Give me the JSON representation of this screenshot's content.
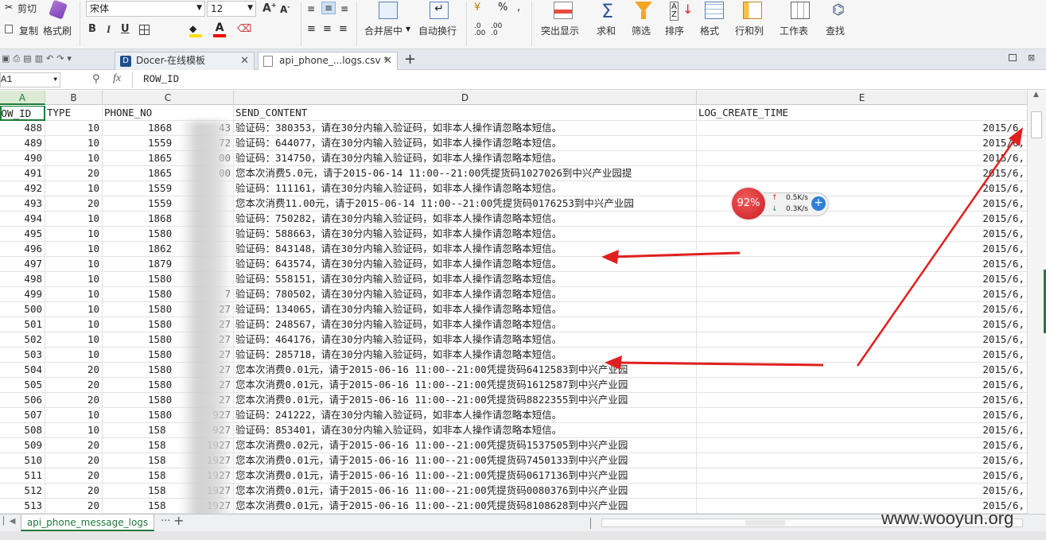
{
  "ribbon": {
    "cut": "剪切",
    "copy": "复制",
    "format_painter": "格式刷",
    "font_name": "宋体",
    "font_size": "12",
    "merge_center": "合并居中",
    "wrap_text": "自动换行",
    "percent": "%",
    "highlight": "突出显示",
    "sum": "求和",
    "filter": "筛选",
    "sort": "排序",
    "format": "格式",
    "row_col": "行和列",
    "worksheet": "工作表",
    "find": "查找",
    "bold": "B",
    "italic": "I",
    "underline": "U",
    "sigma": "Σ"
  },
  "tabs": [
    {
      "label": "Docer-在线模板"
    },
    {
      "label": "api_phone_...logs.csv *"
    }
  ],
  "formula_bar": {
    "name_box": "A1",
    "fx": "fx",
    "content": "ROW_ID"
  },
  "columns": [
    "A",
    "B",
    "C",
    "D",
    "E"
  ],
  "header_row": [
    "ROW_ID",
    "TYPE",
    "PHONE_NO",
    "SEND_CONTENT",
    "LOG_CREATE_TIME"
  ],
  "rows": [
    {
      "id": "488",
      "type": "10",
      "phone": "1868",
      "phone_tail": "43",
      "content": "验证码：380353，请在30分内输入验证码，如非本人操作请忽略本短信。",
      "time": "2015/6,"
    },
    {
      "id": "489",
      "type": "10",
      "phone": "1559",
      "phone_tail": "72",
      "content": "验证码：644077，请在30分内输入验证码，如非本人操作请忽略本短信。",
      "time": "2015/6,"
    },
    {
      "id": "490",
      "type": "10",
      "phone": "1865",
      "phone_tail": "00",
      "content": "验证码：314750，请在30分内输入验证码，如非本人操作请忽略本短信。",
      "time": "2015/6,"
    },
    {
      "id": "491",
      "type": "20",
      "phone": "1865",
      "phone_tail": "00",
      "content": "您本次消费5.0元，请于2015-06-14 11:00--21:00凭提货码1027026到中兴产业园提",
      "time": "2015/6,"
    },
    {
      "id": "492",
      "type": "10",
      "phone": "1559",
      "phone_tail": "",
      "content": "验证码：111161，请在30分内输入验证码，如非本人操作请忽略本短信。",
      "time": "2015/6,"
    },
    {
      "id": "493",
      "type": "20",
      "phone": "1559",
      "phone_tail": "",
      "content": "您本次消费11.00元，请于2015-06-14 11:00--21:00凭提货码0176253到中兴产业园",
      "time": "2015/6,"
    },
    {
      "id": "494",
      "type": "10",
      "phone": "1868",
      "phone_tail": "",
      "content": "验证码：750282，请在30分内输入验证码，如非本人操作请忽略本短信。",
      "time": "2015/6,"
    },
    {
      "id": "495",
      "type": "10",
      "phone": "1580",
      "phone_tail": "",
      "content": "验证码：588663，请在30分内输入验证码，如非本人操作请忽略本短信。",
      "time": "2015/6,"
    },
    {
      "id": "496",
      "type": "10",
      "phone": "1862",
      "phone_tail": "",
      "content": "验证码：843148，请在30分内输入验证码，如非本人操作请忽略本短信。",
      "time": "2015/6,"
    },
    {
      "id": "497",
      "type": "10",
      "phone": "1879",
      "phone_tail": "",
      "content": "验证码：643574，请在30分内输入验证码，如非本人操作请忽略本短信。",
      "time": "2015/6,"
    },
    {
      "id": "498",
      "type": "10",
      "phone": "1580",
      "phone_tail": "",
      "content": "验证码：558151，请在30分内输入验证码，如非本人操作请忽略本短信。",
      "time": "2015/6,"
    },
    {
      "id": "499",
      "type": "10",
      "phone": "1580",
      "phone_tail": "7",
      "content": "验证码：780502，请在30分内输入验证码，如非本人操作请忽略本短信。",
      "time": "2015/6,"
    },
    {
      "id": "500",
      "type": "10",
      "phone": "1580",
      "phone_tail": "27",
      "content": "验证码：134065，请在30分内输入验证码，如非本人操作请忽略本短信。",
      "time": "2015/6,"
    },
    {
      "id": "501",
      "type": "10",
      "phone": "1580",
      "phone_tail": "27",
      "content": "验证码：248567，请在30分内输入验证码，如非本人操作请忽略本短信。",
      "time": "2015/6,"
    },
    {
      "id": "502",
      "type": "10",
      "phone": "1580",
      "phone_tail": "27",
      "content": "验证码：464176，请在30分内输入验证码，如非本人操作请忽略本短信。",
      "time": "2015/6,"
    },
    {
      "id": "503",
      "type": "10",
      "phone": "1580",
      "phone_tail": "27",
      "content": "验证码：285718，请在30分内输入验证码，如非本人操作请忽略本短信。",
      "time": "2015/6,"
    },
    {
      "id": "504",
      "type": "20",
      "phone": "1580",
      "phone_tail": "27",
      "content": "您本次消费0.01元，请于2015-06-16 11:00--21:00凭提货码6412583到中兴产业园",
      "time": "2015/6,"
    },
    {
      "id": "505",
      "type": "20",
      "phone": "1580",
      "phone_tail": "27",
      "content": "您本次消费0.01元，请于2015-06-16 11:00--21:00凭提货码1612587到中兴产业园",
      "time": "2015/6,"
    },
    {
      "id": "506",
      "type": "20",
      "phone": "1580",
      "phone_tail": "27",
      "content": "您本次消费0.01元，请于2015-06-16 11:00--21:00凭提货码8822355到中兴产业园",
      "time": "2015/6,"
    },
    {
      "id": "507",
      "type": "10",
      "phone": "1580",
      "phone_tail": "927",
      "content": "验证码：241222，请在30分内输入验证码，如非本人操作请忽略本短信。",
      "time": "2015/6,"
    },
    {
      "id": "508",
      "type": "10",
      "phone": "158",
      "phone_tail": "927",
      "content": "验证码：853401，请在30分内输入验证码，如非本人操作请忽略本短信。",
      "time": "2015/6,"
    },
    {
      "id": "509",
      "type": "20",
      "phone": "158",
      "phone_tail": "1927",
      "content": "您本次消费0.02元，请于2015-06-16 11:00--21:00凭提货码1537505到中兴产业园",
      "time": "2015/6,"
    },
    {
      "id": "510",
      "type": "20",
      "phone": "158",
      "phone_tail": "1927",
      "content": "您本次消费0.01元，请于2015-06-16 11:00--21:00凭提货码7450133到中兴产业园",
      "time": "2015/6,"
    },
    {
      "id": "511",
      "type": "20",
      "phone": "158",
      "phone_tail": "1927",
      "content": "您本次消费0.01元，请于2015-06-16 11:00--21:00凭提货码0617136到中兴产业园",
      "time": "2015/6,"
    },
    {
      "id": "512",
      "type": "20",
      "phone": "158",
      "phone_tail": "1927",
      "content": "您本次消费0.01元，请于2015-06-16 11:00--21:00凭提货码0080376到中兴产业园",
      "time": "2015/6,"
    },
    {
      "id": "513",
      "type": "20",
      "phone": "158",
      "phone_tail": "1927",
      "content": "您本次消费0.01元，请于2015-06-16 11:00--21:00凭提货码8108628到中兴产业园",
      "time": "2015/6,"
    }
  ],
  "sheet_tab": "api_phone_message_logs",
  "sheet_more": "···",
  "sheet_add": "+",
  "widget": {
    "percent": "92%",
    "up": "0.5K/s",
    "down": "0.3K/s"
  },
  "watermark": "www.wooyun.org",
  "colors": {
    "accent_green": "#1e7a3a",
    "arrow_red": "#e02020",
    "widget_red": "#d9252b"
  }
}
